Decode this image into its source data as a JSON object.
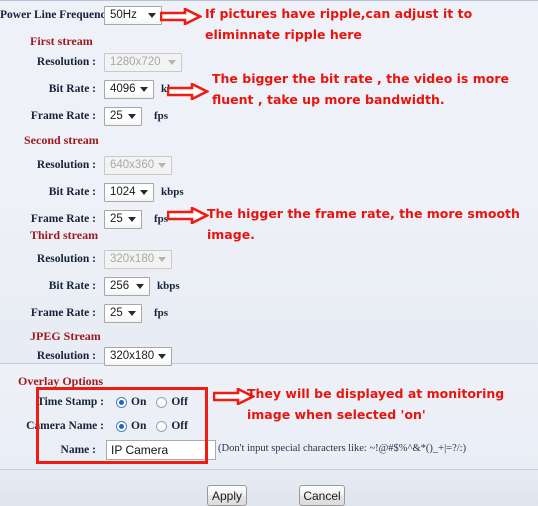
{
  "form": {
    "power_line": {
      "label": "Power Line Frequency :",
      "value": "50Hz"
    },
    "sections": [
      {
        "title": "First stream",
        "rows": [
          {
            "label": "Resolution :",
            "value": "1280x720",
            "unit": "",
            "disabled": true
          },
          {
            "label": "Bit Rate :",
            "value": "4096",
            "unit": "kbps",
            "disabled": false
          },
          {
            "label": "Frame Rate :",
            "value": "25",
            "unit": "fps",
            "disabled": false
          }
        ]
      },
      {
        "title": "Second stream",
        "rows": [
          {
            "label": "Resolution :",
            "value": "640x360",
            "unit": "",
            "disabled": true
          },
          {
            "label": "Bit Rate :",
            "value": "1024",
            "unit": "kbps",
            "disabled": false
          },
          {
            "label": "Frame Rate :",
            "value": "25",
            "unit": "fps",
            "disabled": false
          }
        ]
      },
      {
        "title": "Third stream",
        "rows": [
          {
            "label": "Resolution :",
            "value": "320x180",
            "unit": "",
            "disabled": true
          },
          {
            "label": "Bit Rate :",
            "value": "256",
            "unit": "kbps",
            "disabled": false
          },
          {
            "label": "Frame Rate :",
            "value": "25",
            "unit": "fps",
            "disabled": false
          }
        ]
      },
      {
        "title": "JPEG Stream",
        "rows": [
          {
            "label": "Resolution :",
            "value": "320x180",
            "unit": "",
            "disabled": false
          }
        ]
      }
    ],
    "overlay": {
      "title": "Overlay Options",
      "time_stamp": {
        "label": "Time Stamp :",
        "on": "On",
        "off": "Off",
        "selected": "On"
      },
      "camera_name": {
        "label": "Camera Name :",
        "on": "On",
        "off": "Off",
        "selected": "On"
      },
      "name": {
        "label": "Name :",
        "value": "IP Camera"
      },
      "hint": "(Don't input special characters like: ~!@#$%^&*()_+|=?/:)"
    },
    "buttons": {
      "apply": "Apply",
      "cancel": "Cancel"
    }
  },
  "annotations": [
    {
      "id": "ann-power-line",
      "text": "If pictures have ripple,can adjust it to\neliminnate ripple here"
    },
    {
      "id": "ann-bit-rate",
      "text": "The bigger the bit rate , the video is more\nfluent , take up more bandwidth."
    },
    {
      "id": "ann-frame-rate",
      "text": "The higger the frame rate, the more smooth\nimage."
    },
    {
      "id": "ann-overlay",
      "text": "They will be displayed at monitoring\nimage when selected 'on'"
    }
  ],
  "colors": {
    "annotation_red": "#e8150f",
    "section_title_red": "#9e1b20",
    "radio_blue": "#1769c4",
    "panel_bg": "#eef1f7"
  }
}
